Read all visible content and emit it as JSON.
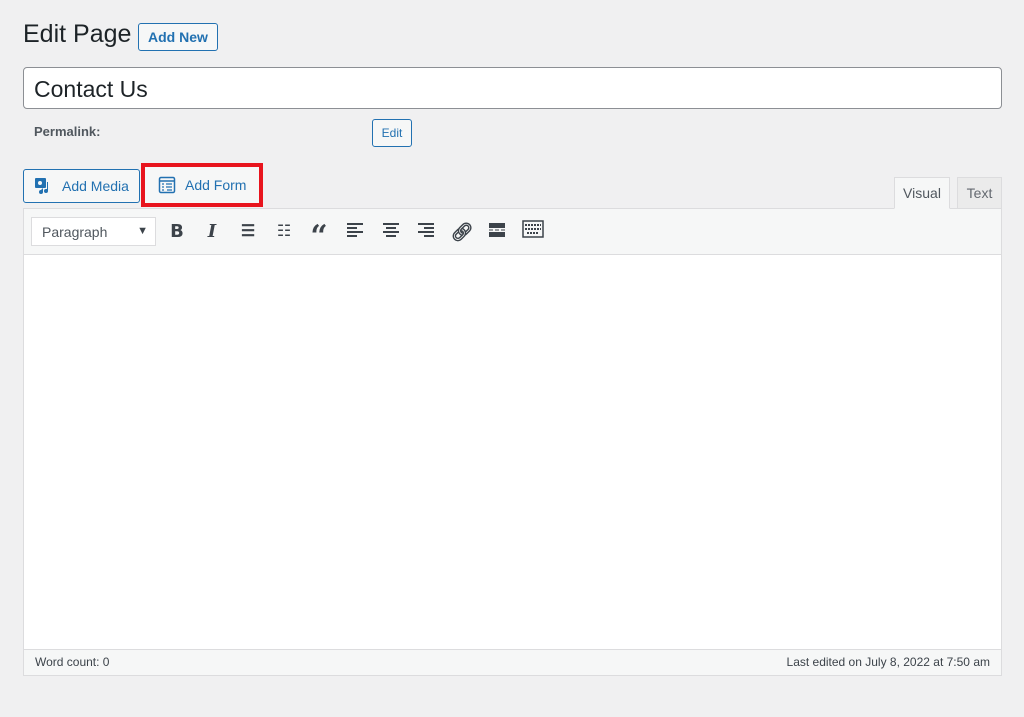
{
  "header": {
    "title": "Edit Page",
    "add_new": "Add New"
  },
  "post_title": "Contact Us",
  "permalink": {
    "label": "Permalink:",
    "edit": "Edit"
  },
  "media_buttons": {
    "add_media": "Add Media",
    "add_form": "Add Form"
  },
  "editor_tabs": {
    "visual": "Visual",
    "text": "Text"
  },
  "toolbar": {
    "format_select": "Paragraph"
  },
  "status": {
    "word_count": "Word count: 0",
    "last_edited": "Last edited on July 8, 2022 at 7:50 am"
  },
  "colors": {
    "accent": "#2271b1",
    "highlight": "#e8141d"
  }
}
